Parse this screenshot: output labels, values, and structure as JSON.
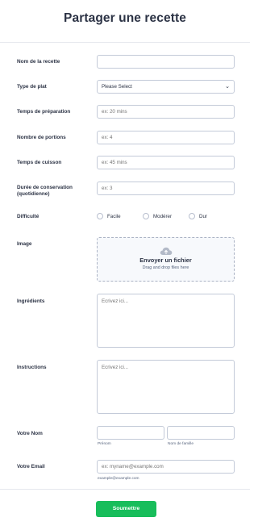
{
  "form": {
    "title": "Partager une recette",
    "submit_label": "Soumettre"
  },
  "fields": {
    "recipe_name": {
      "label": "Nom de la recette",
      "value": "",
      "placeholder": ""
    },
    "dish_type": {
      "label": "Type de plat",
      "value": "Please Select"
    },
    "prep_time": {
      "label": "Temps de préparation",
      "placeholder": "ex: 20 mins"
    },
    "servings": {
      "label": "Nombre de portions",
      "placeholder": "ex: 4"
    },
    "cook_time": {
      "label": "Temps de cuisson",
      "placeholder": "ex: 45 mins"
    },
    "shelf_life": {
      "label": "Durée de conservation (quotidienne)",
      "placeholder": "ex: 3"
    },
    "difficulty": {
      "label": "Difficulté",
      "options": [
        "Facile",
        "Modérer",
        "Dur"
      ]
    },
    "image": {
      "label": "Image",
      "upload_title": "Envoyer un fichier",
      "upload_subtitle": "Drag and drop files here",
      "icon": "cloud-upload-icon"
    },
    "ingredients": {
      "label": "Ingrédients",
      "placeholder": "Ecrivez ici..."
    },
    "instructions": {
      "label": "Instructions",
      "placeholder": "Ecrivez ici..."
    },
    "name": {
      "label": "Votre Nom",
      "first_sublabel": "Prénom",
      "last_sublabel": "Nom de famille"
    },
    "email": {
      "label": "Votre Email",
      "placeholder": "ex: myname@example.com",
      "sublabel": "example@example.com"
    }
  },
  "colors": {
    "submit_bg": "#18bd5b",
    "text": "#2c3345",
    "border": "#c3cad8"
  }
}
